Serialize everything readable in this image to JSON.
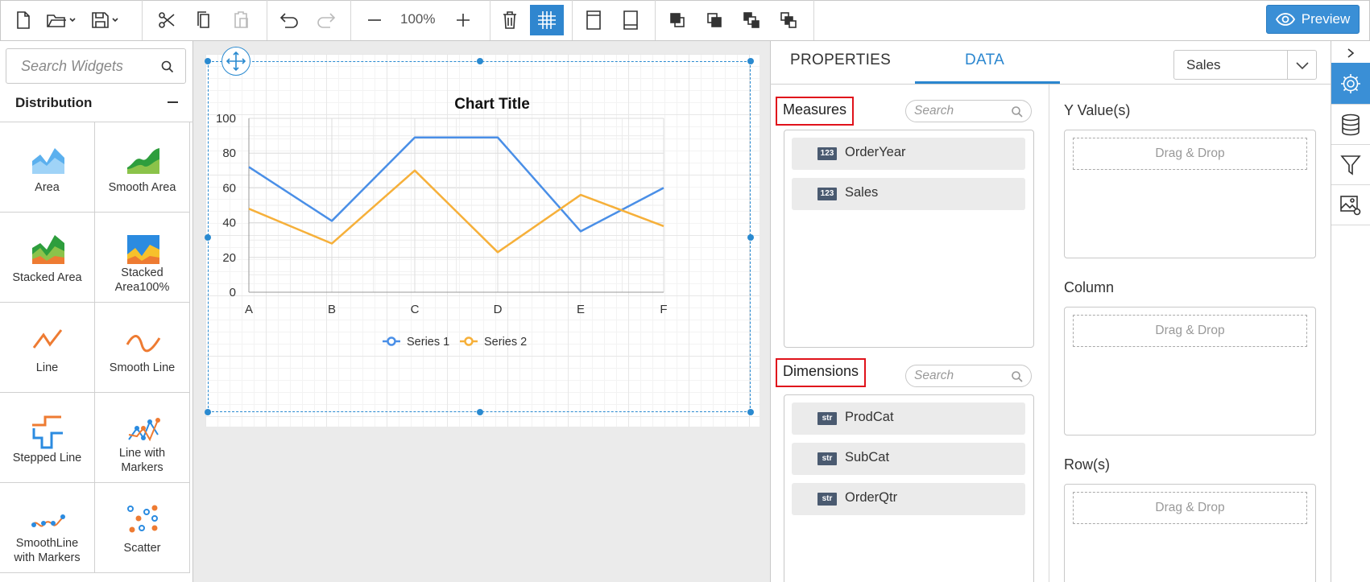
{
  "toolbar": {
    "zoom": "100%",
    "icons": [
      "new-file-icon",
      "open-folder-icon",
      "save-icon",
      "cut-icon",
      "copy-icon",
      "paste-icon",
      "undo-icon",
      "redo-icon",
      "zoom-out-icon",
      "zoom-in-icon",
      "delete-icon",
      "grid-icon",
      "header-icon",
      "footer-icon",
      "bring-forward-icon",
      "bring-to-front-icon",
      "send-backward-icon",
      "send-to-back-icon"
    ],
    "preview_label": "Preview",
    "accent": "#2f86cf"
  },
  "widgets": {
    "search_placeholder": "Search Widgets",
    "category": "Distribution",
    "items": [
      {
        "label": "Area",
        "icon": "area-chart-icon"
      },
      {
        "label": "Smooth Area",
        "icon": "smooth-area-chart-icon"
      },
      {
        "label": "Stacked Area",
        "icon": "stacked-area-chart-icon"
      },
      {
        "label": "Stacked\nArea100%",
        "icon": "stacked-area100-chart-icon"
      },
      {
        "label": "Line",
        "icon": "line-chart-icon"
      },
      {
        "label": "Smooth Line",
        "icon": "smooth-line-chart-icon"
      },
      {
        "label": "Stepped Line",
        "icon": "stepped-line-chart-icon"
      },
      {
        "label": "Line with\nMarkers",
        "icon": "line-markers-chart-icon"
      },
      {
        "label": "SmoothLine\nwith Markers",
        "icon": "smooth-line-markers-chart-icon"
      },
      {
        "label": "Scatter",
        "icon": "scatter-chart-icon"
      }
    ]
  },
  "chart_data": {
    "type": "line",
    "title": "Chart Title",
    "categories": [
      "A",
      "B",
      "C",
      "D",
      "E",
      "F"
    ],
    "series": [
      {
        "name": "Series 1",
        "values": [
          72,
          41,
          89,
          89,
          35,
          60
        ],
        "color": "#4a8fe7"
      },
      {
        "name": "Series 2",
        "values": [
          48,
          28,
          70,
          23,
          56,
          38
        ],
        "color": "#f6b03a"
      }
    ],
    "ylim": [
      0,
      100
    ],
    "yticks": [
      0,
      20,
      40,
      60,
      80,
      100
    ],
    "grid": true,
    "legend": "bottom"
  },
  "properties": {
    "tab_properties": "PROPERTIES",
    "tab_data": "DATA",
    "datasource": "Sales",
    "measures_label": "Measures",
    "dimensions_label": "Dimensions",
    "search_placeholder": "Search",
    "measures": [
      {
        "badge": "123",
        "name": "OrderYear"
      },
      {
        "badge": "123",
        "name": "Sales"
      }
    ],
    "dimensions": [
      {
        "badge": "str",
        "name": "ProdCat"
      },
      {
        "badge": "str",
        "name": "SubCat"
      },
      {
        "badge": "str",
        "name": "OrderQtr"
      }
    ],
    "y_values_label": "Y Value(s)",
    "column_label": "Column",
    "rows_label": "Row(s)",
    "drop_text": "Drag & Drop",
    "highlight_color": "#e0121b"
  },
  "sidebar_strip": {
    "icons": [
      "collapse-icon",
      "settings-icon",
      "database-icon",
      "filter-icon",
      "image-settings-icon"
    ]
  }
}
